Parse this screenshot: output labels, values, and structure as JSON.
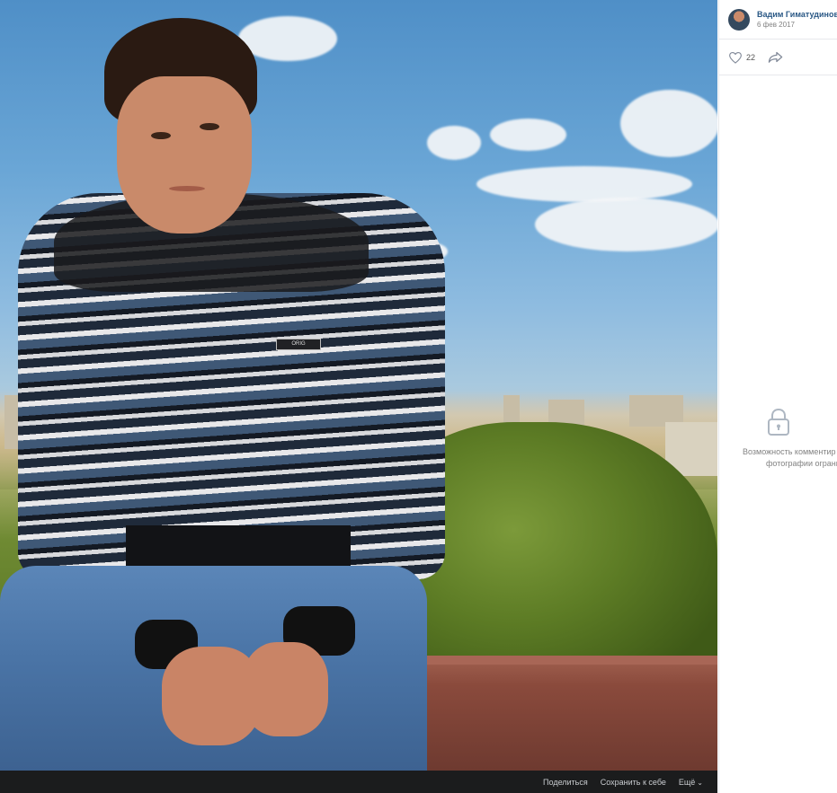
{
  "author": {
    "name": "Вадим Гиматудинов",
    "date": "6 фев 2017"
  },
  "actions": {
    "like_count": "22",
    "like_icon": "heart-icon",
    "share_icon": "share-arrow-icon"
  },
  "comments": {
    "lock_icon": "lock-icon",
    "notice_line1": "Возможность комментир",
    "notice_line2": "фотографии ограни"
  },
  "bottom_bar": {
    "share_label": "Поделиться",
    "save_label": "Сохранить к себе",
    "more_label": "Ещё"
  },
  "photo": {
    "sweater_badge": "ORIG"
  },
  "colors": {
    "link": "#2a5885",
    "bottom_bar": "#1b1c1d",
    "muted_text": "#828282"
  }
}
